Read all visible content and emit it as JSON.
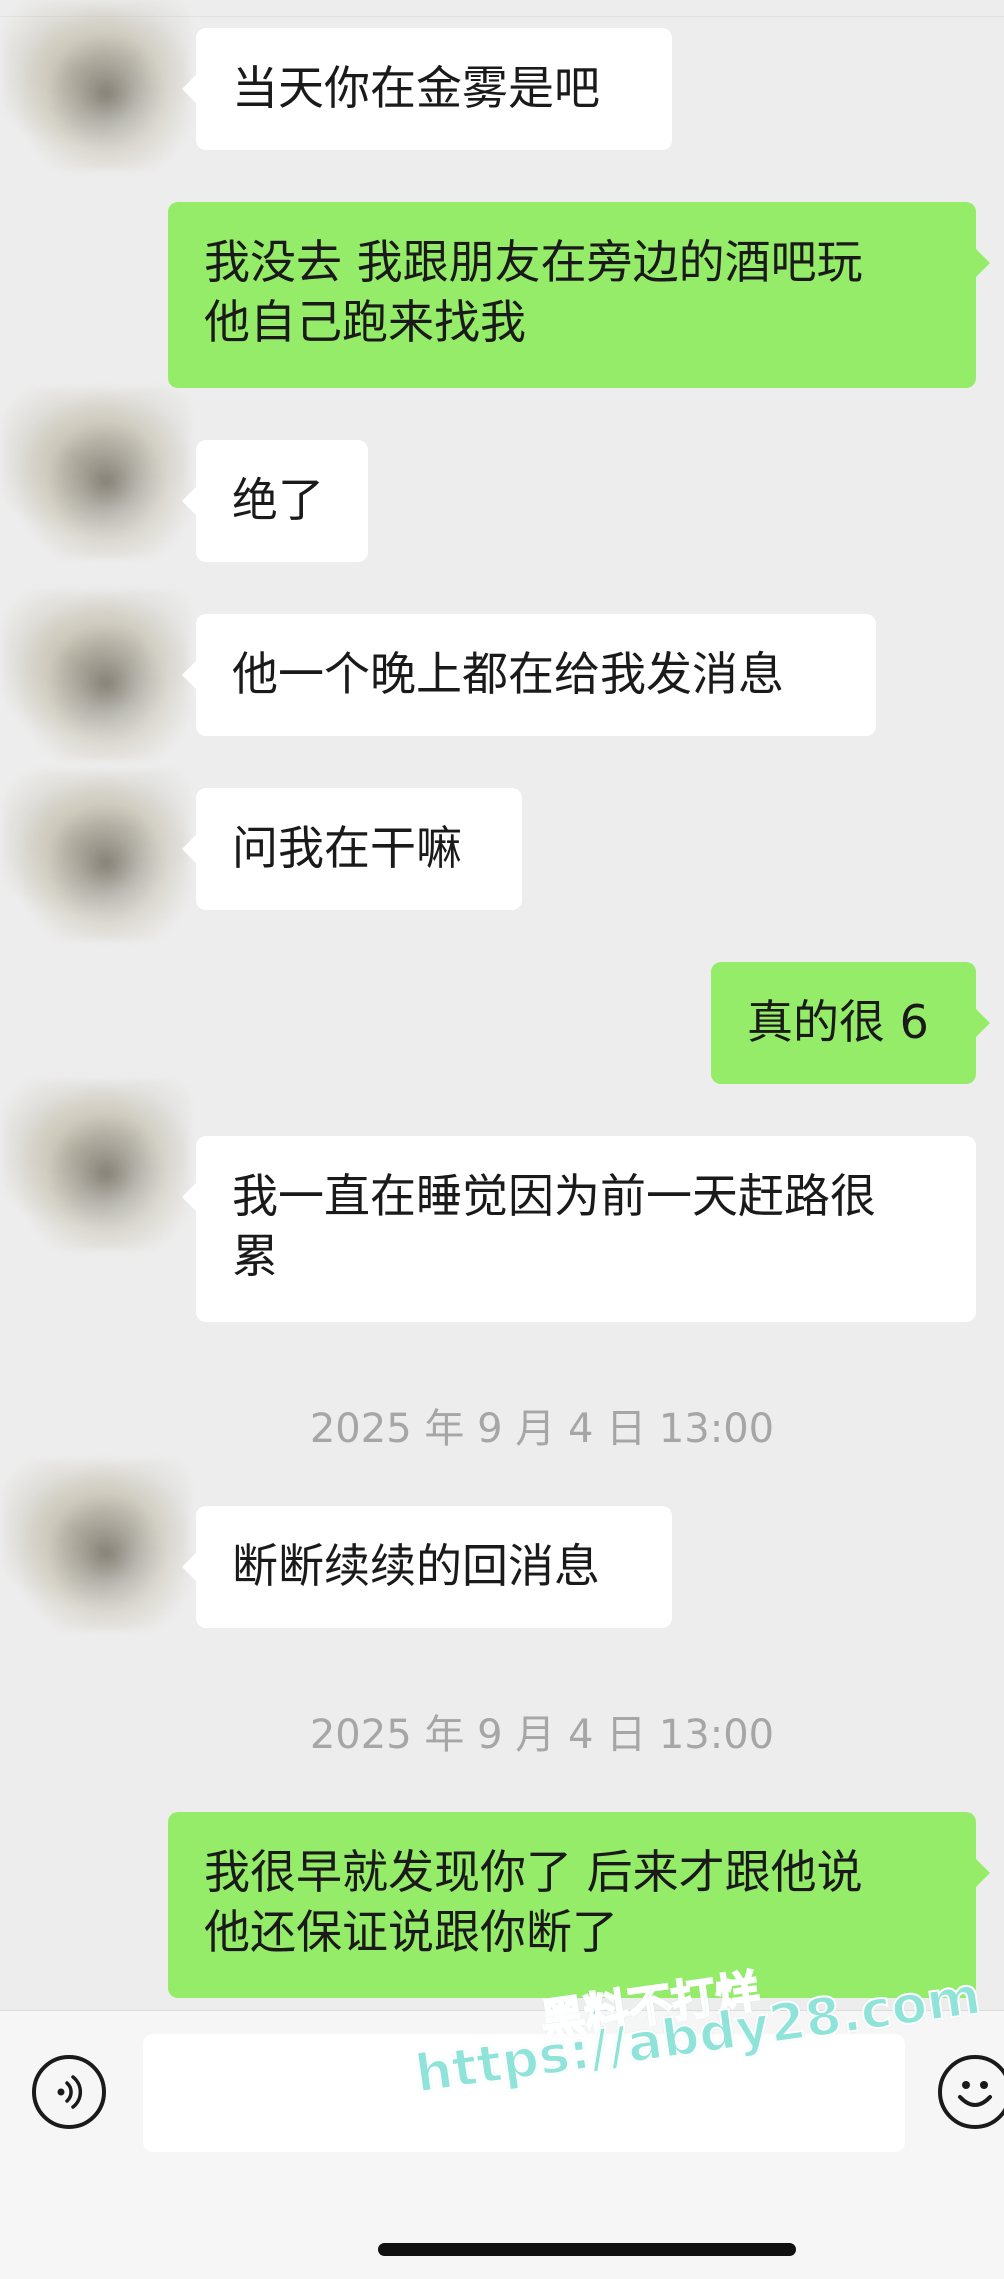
{
  "messages": [
    {
      "side": "in",
      "text": "当天你在金雾是吧"
    },
    {
      "side": "out",
      "text": "我没去 我跟朋友在旁边的酒吧玩\n他自己跑来找我"
    },
    {
      "side": "in",
      "text": "绝了"
    },
    {
      "side": "in",
      "text": "他一个晚上都在给我发消息"
    },
    {
      "side": "in",
      "text": "问我在干嘛"
    },
    {
      "side": "out",
      "text": "真的很 6"
    },
    {
      "side": "in",
      "text": "我一直在睡觉因为前一天赶路很\n累"
    },
    {
      "timestamp": "2025 年 9 月 4 日 13:00"
    },
    {
      "side": "in",
      "text": "断断续续的回消息"
    },
    {
      "timestamp": "2025 年 9 月 4 日 13:00"
    },
    {
      "side": "out",
      "text": "我很早就发现你了 后来才跟他说\n他还保证说跟你断了"
    }
  ],
  "input": {
    "value": "",
    "voice_icon": "voice-icon",
    "emoji_icon": "emoji-icon"
  },
  "watermark": {
    "title": "黑料不打烊",
    "url": "https://abdy28.com"
  },
  "colors": {
    "background": "#ededed",
    "incoming_bubble": "#ffffff",
    "outgoing_bubble": "#95ec69",
    "timestamp_text": "#a6a6a6"
  }
}
